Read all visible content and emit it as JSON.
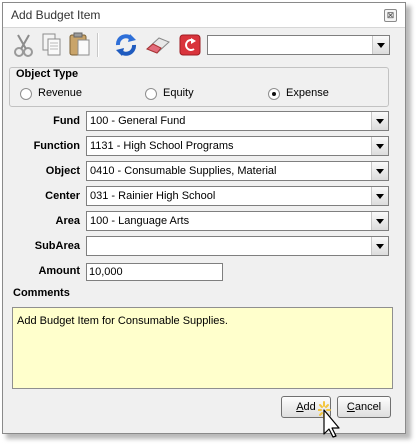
{
  "dialog": {
    "title": "Add Budget Item",
    "close_symbol": "⊠"
  },
  "toolbar": {
    "icons": [
      "scissors-icon",
      "copy-icon",
      "paste-icon",
      "refresh-icon",
      "eraser-icon",
      "undo-icon"
    ],
    "search_value": ""
  },
  "object_type": {
    "legend": "Object Type",
    "options": [
      {
        "label": "Revenue",
        "selected": false
      },
      {
        "label": "Equity",
        "selected": false
      },
      {
        "label": "Expense",
        "selected": true
      }
    ]
  },
  "fields": {
    "fund": {
      "label": "Fund",
      "value": "100 - General Fund"
    },
    "function": {
      "label": "Function",
      "value": "1131 - High School Programs"
    },
    "object": {
      "label": "Object",
      "value": "0410 - Consumable Supplies, Material"
    },
    "center": {
      "label": "Center",
      "value": "031 - Rainier High School"
    },
    "area": {
      "label": "Area",
      "value": "100 - Language Arts"
    },
    "subarea": {
      "label": "SubArea",
      "value": ""
    },
    "amount": {
      "label": "Amount",
      "value": "10,000"
    }
  },
  "comments": {
    "label": "Comments",
    "value": "Add Budget Item for Consumable Supplies."
  },
  "buttons": {
    "add_first": "A",
    "add_rest": "dd",
    "cancel_first": "C",
    "cancel_rest": "ancel"
  }
}
